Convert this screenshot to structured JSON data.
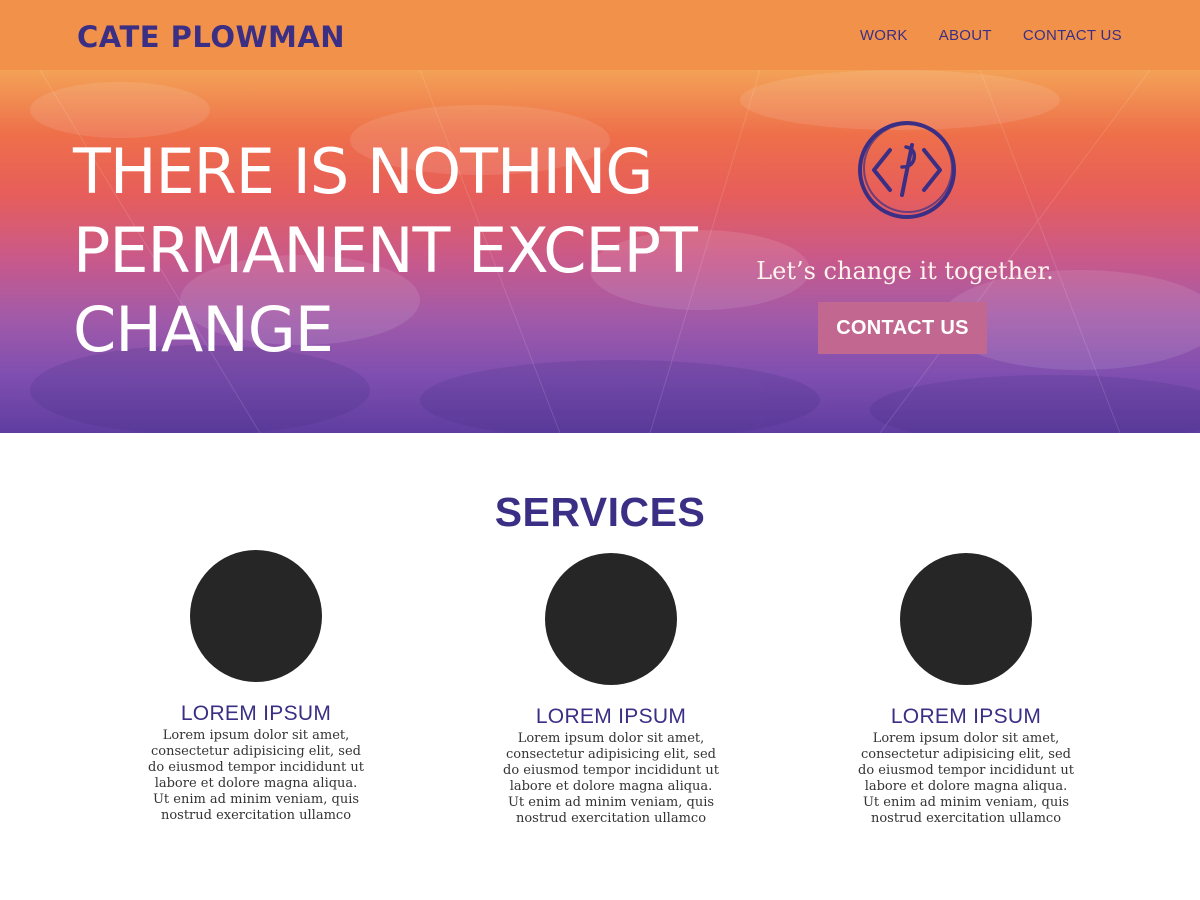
{
  "header": {
    "brand": "CATE PLOWMAN",
    "nav": [
      {
        "label": "WORK"
      },
      {
        "label": "ABOUT"
      },
      {
        "label": "CONTACT US"
      }
    ]
  },
  "hero": {
    "headline_lines": [
      "THERE IS NOTHING",
      "PERMANENT EXCEPT",
      "CHANGE"
    ],
    "logo_icon": "code-brackets-icon",
    "tagline": "Let’s change it together.",
    "cta_label": "CONTACT US"
  },
  "services": {
    "title": "SERVICES",
    "items": [
      {
        "title": "LOREM IPSUM",
        "text": "Lorem ipsum dolor sit amet, consectetur adipisicing elit, sed do eiusmod tempor incididunt ut labore et dolore magna aliqua. Ut enim ad minim veniam, quis nostrud exercitation ullamco"
      },
      {
        "title": "LOREM IPSUM",
        "text": "Lorem ipsum dolor sit amet, consectetur adipisicing elit, sed do eiusmod tempor incididunt ut labore et dolore magna aliqua. Ut enim ad minim veniam, quis nostrud exercitation ullamco"
      },
      {
        "title": "LOREM IPSUM",
        "text": "Lorem ipsum dolor sit amet, consectetur adipisicing elit, sed do eiusmod tempor incididunt ut labore et dolore magna aliqua. Ut enim ad minim veniam, quis nostrud exercitation ullamco"
      }
    ]
  },
  "colors": {
    "header_bg": "#f2924a",
    "brand_purple": "#3a2f85",
    "cta_pink": "#c2678f",
    "service_circle": "#262626"
  }
}
